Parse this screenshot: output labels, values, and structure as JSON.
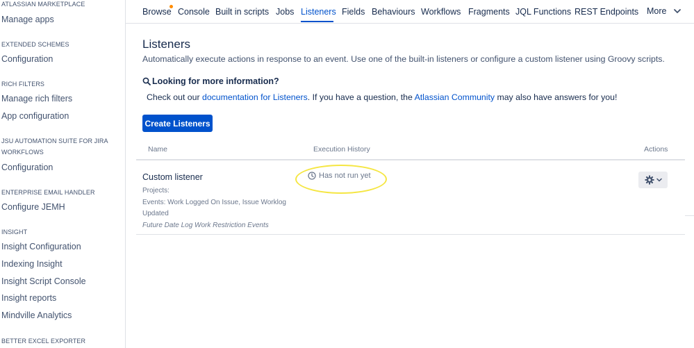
{
  "sidebar": {
    "sections": [
      {
        "heading": "ATLASSIAN MARKETPLACE",
        "links": [
          "Manage apps"
        ]
      },
      {
        "heading": "EXTENDED SCHEMES",
        "links": [
          "Configuration"
        ]
      },
      {
        "heading": "RICH FILTERS",
        "links": [
          "Manage rich filters",
          "App configuration"
        ]
      },
      {
        "heading": "JSU AUTOMATION SUITE FOR JIRA WORKFLOWS",
        "links": [
          "Configuration"
        ]
      },
      {
        "heading": "ENTERPRISE EMAIL HANDLER",
        "links": [
          "Configure JEMH"
        ]
      },
      {
        "heading": "INSIGHT",
        "links": [
          "Insight Configuration",
          "Indexing Insight",
          "Insight Script Console",
          "Insight reports",
          "Mindville Analytics"
        ]
      },
      {
        "heading": "BETTER EXCEL EXPORTER",
        "links": []
      }
    ]
  },
  "nav": {
    "items": [
      "Browse",
      "Console",
      "Built in scripts",
      "Jobs",
      "Listeners",
      "Fields",
      "Behaviours",
      "Workflows",
      "Fragments",
      "JQL Functions",
      "REST Endpoints",
      "More"
    ],
    "active": "Listeners"
  },
  "page": {
    "title": "Listeners",
    "description": "Automatically execute actions in response to an event. Use one of the built-in listeners or configure a custom listener using Groovy scripts.",
    "info_title": "Looking for more information?",
    "info_text_1": "Check out our ",
    "info_link_1": "documentation for Listeners",
    "info_text_2": ". If you have a question, the ",
    "info_link_2": "Atlassian Community",
    "info_text_3": " may also have answers for you!",
    "create_button": "Create Listeners"
  },
  "table": {
    "columns": [
      "Name",
      "Execution History",
      "Actions"
    ],
    "rows": [
      {
        "name": "Custom listener",
        "projects": "Projects:",
        "events": "Events: Work Logged On Issue, Issue Worklog",
        "events_cont": "Updated",
        "description": "Future Date Log Work Restriction Events",
        "execution": "Has not run yet"
      }
    ]
  },
  "colors": {
    "accent": "#0052cc",
    "notification": "#ff8b00",
    "highlight": "#f5e642"
  }
}
